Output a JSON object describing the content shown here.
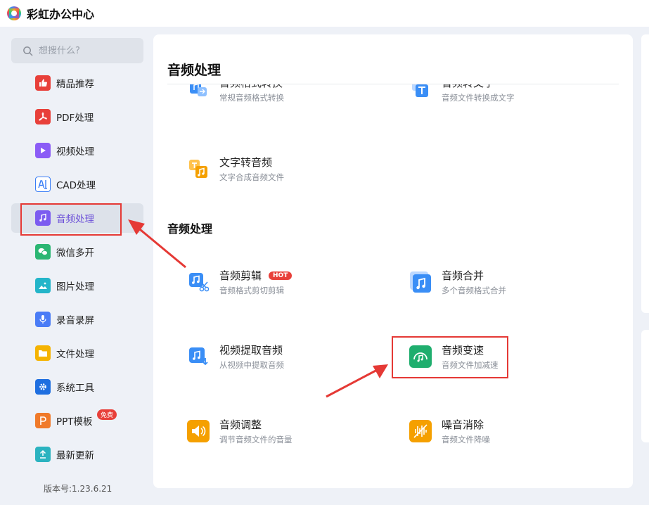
{
  "app": {
    "title": "彩虹办公中心"
  },
  "search": {
    "placeholder": "想搜什么?"
  },
  "sidebar": {
    "items": [
      {
        "label": "精品推荐",
        "icon": "thumbs-up-icon",
        "color": "#e8403a"
      },
      {
        "label": "PDF处理",
        "icon": "pdf-icon",
        "color": "#e8403a"
      },
      {
        "label": "视频处理",
        "icon": "video-play-icon",
        "color": "#8b5cf6"
      },
      {
        "label": "CAD处理",
        "icon": "cad-icon",
        "color": "#3a7ef6"
      },
      {
        "label": "音频处理",
        "icon": "music-note-icon",
        "color": "#7c5cf0"
      },
      {
        "label": "微信多开",
        "icon": "wechat-icon",
        "color": "#2bb673"
      },
      {
        "label": "图片处理",
        "icon": "image-icon",
        "color": "#23b5c9"
      },
      {
        "label": "录音录屏",
        "icon": "microphone-icon",
        "color": "#4a7cf6"
      },
      {
        "label": "文件处理",
        "icon": "folder-icon",
        "color": "#f5b301"
      },
      {
        "label": "系统工具",
        "icon": "gear-icon",
        "color": "#1f6fe0"
      },
      {
        "label": "PPT模板",
        "icon": "ppt-icon",
        "color": "#f07a2a",
        "badge": "免费"
      },
      {
        "label": "最新更新",
        "icon": "upload-icon",
        "color": "#2bb3c0"
      }
    ],
    "active_index": 4,
    "version": "版本号:1.23.6.21"
  },
  "main": {
    "title": "音频处理",
    "top_cards": [
      {
        "name": "音频格式转换",
        "desc": "常规音频格式转换",
        "icon": "audio-convert-icon"
      },
      {
        "name": "音频转文字",
        "desc": "音频文件转换成文字",
        "icon": "audio-to-text-icon"
      },
      {
        "name": "文字转音频",
        "desc": "文字合成音频文件",
        "icon": "text-to-audio-icon"
      }
    ],
    "section2_title": "音频处理",
    "cards": [
      {
        "name": "音频剪辑",
        "desc": "音频格式剪切剪辑",
        "icon": "audio-cut-icon",
        "badge": "HOT"
      },
      {
        "name": "音频合并",
        "desc": "多个音频格式合并",
        "icon": "audio-merge-icon"
      },
      {
        "name": "视频提取音频",
        "desc": "从视频中提取音频",
        "icon": "extract-audio-icon"
      },
      {
        "name": "音频变速",
        "desc": "音频文件加减速",
        "icon": "audio-speed-icon"
      },
      {
        "name": "音频调整",
        "desc": "调节音频文件的音量",
        "icon": "volume-icon"
      },
      {
        "name": "噪音消除",
        "desc": "音频文件降噪",
        "icon": "noise-reduction-icon"
      }
    ]
  },
  "colors": {
    "accent": "#6b4fd8",
    "highlight": "#e53935",
    "blue_icon": "#3a8ef6",
    "green_icon": "#1fae6e",
    "orange_icon": "#f5a000"
  }
}
